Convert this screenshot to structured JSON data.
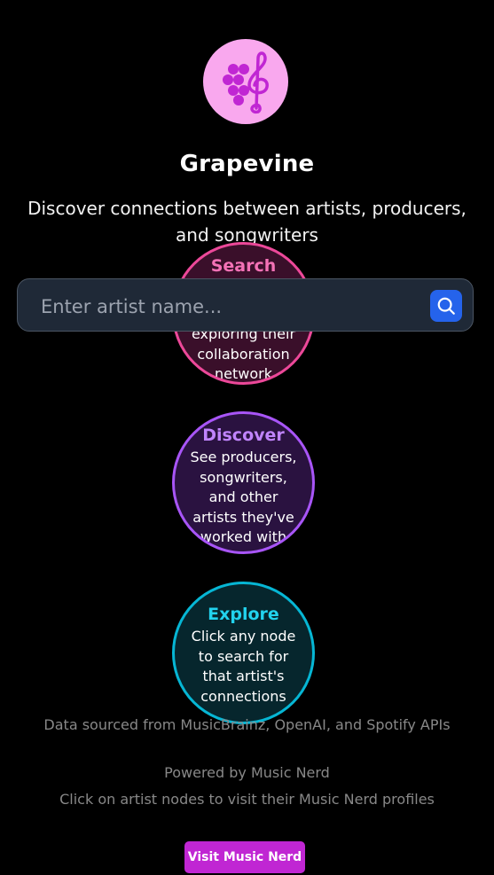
{
  "header": {
    "logo_icon": "grapes-treble-clef-icon",
    "title": "Grapevine",
    "subtitle": "Discover connections between artists, producers, and songwriters"
  },
  "search": {
    "placeholder": "Enter artist name...",
    "button_icon": "search-icon"
  },
  "steps": [
    {
      "title": "Search",
      "body": "exploring their collaboration network",
      "color": "#ec4899"
    },
    {
      "title": "Discover",
      "body": "See producers, songwriters, and other artists they've worked with",
      "color": "#a855f7"
    },
    {
      "title": "Explore",
      "body": "Click any node to search for that artist's connections",
      "color": "#06b6d4"
    }
  ],
  "footer": {
    "data_source": "Data sourced from MusicBrainz, OpenAI, and Spotify APIs",
    "powered_by": "Powered by Music Nerd",
    "hint": "Click on artist nodes to visit their Music Nerd profiles",
    "button_label": "Visit Music Nerd"
  },
  "colors": {
    "background": "#000000",
    "logo_bg": "#f9a8ee",
    "logo_fg": "#c026d3",
    "search_button": "#2563eb",
    "visit_button": "#c026d3"
  }
}
